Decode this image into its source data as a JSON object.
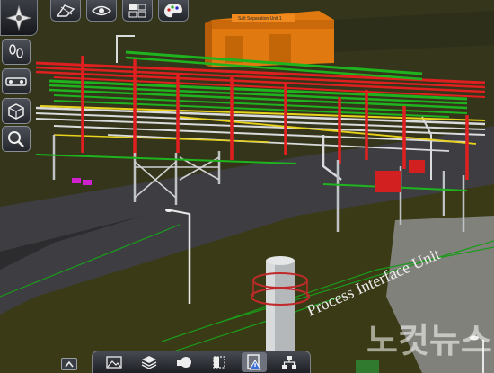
{
  "scene": {
    "floor_label": "Process Interface Unit",
    "small_sign": "Salt Separation Unit 1"
  },
  "watermark": {
    "text": "노컷뉴스"
  },
  "toolbar": {
    "main_icon": "compass-icon",
    "buttons": [
      "section-view-icon",
      "eye-icon",
      "grid-select-icon",
      "palette-icon"
    ]
  },
  "sidebar": {
    "buttons": [
      "walk-icon",
      "path-icon",
      "cube-view-icon",
      "zoom-icon"
    ]
  },
  "bottom_bar": {
    "buttons": [
      "image-icon",
      "layers-icon",
      "shapes-icon",
      "half-square-icon",
      "warning-doc-icon",
      "hierarchy-icon"
    ],
    "active": "warning-doc-icon"
  },
  "colors": {
    "pipe_red": "#e02020",
    "pipe_green": "#1fb31f",
    "pipe_yellow": "#e8d21c",
    "building_orange": "#e07a10",
    "ground_olive": "#3a3a18",
    "road": "#3b3b3e"
  }
}
